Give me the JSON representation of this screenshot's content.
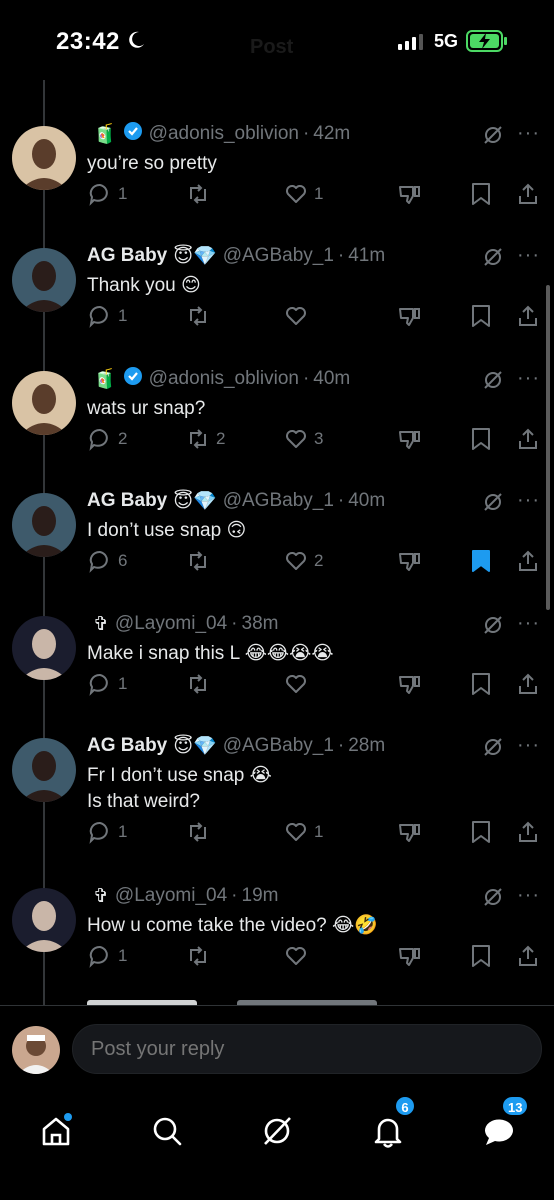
{
  "status": {
    "time": "23:42",
    "network": "5G"
  },
  "header_ghost": "Post",
  "tweets": [
    {
      "display_name": "",
      "badge_emoji": "🧃",
      "verified": true,
      "handle": "@adonis_oblivion",
      "ago": "42m",
      "lines": [
        "you’re so pretty"
      ],
      "emoji": "",
      "replies": "1",
      "reposts": "",
      "likes": "1",
      "bookmarked": false
    },
    {
      "display_name": "AG Baby",
      "badge_emoji": "😇💎",
      "verified": false,
      "handle": "@AGBaby_1",
      "ago": "41m",
      "lines": [
        "Thank you"
      ],
      "emoji": "😊",
      "replies": "1",
      "reposts": "",
      "likes": "",
      "bookmarked": false
    },
    {
      "display_name": "",
      "badge_emoji": "🧃",
      "verified": true,
      "handle": "@adonis_oblivion",
      "ago": "40m",
      "lines": [
        "wats ur snap?"
      ],
      "emoji": "",
      "replies": "2",
      "reposts": "2",
      "likes": "3",
      "bookmarked": false
    },
    {
      "display_name": "AG Baby",
      "badge_emoji": "😇💎",
      "verified": false,
      "handle": "@AGBaby_1",
      "ago": "40m",
      "lines": [
        "I don’t use snap"
      ],
      "emoji": "🙃",
      "replies": "6",
      "reposts": "",
      "likes": "2",
      "bookmarked": true
    },
    {
      "display_name": "",
      "badge_emoji": "✞",
      "verified": false,
      "handle": "@Layomi_04",
      "ago": "38m",
      "lines": [
        "Make i snap this L"
      ],
      "emoji": "😂😂😭😭",
      "replies": "1",
      "reposts": "",
      "likes": "",
      "bookmarked": false
    },
    {
      "display_name": "AG Baby",
      "badge_emoji": "😇💎",
      "verified": false,
      "handle": "@AGBaby_1",
      "ago": "28m",
      "lines": [
        "Fr I don’t use snap",
        "Is that weird?"
      ],
      "emoji": "😭",
      "replies": "1",
      "reposts": "",
      "likes": "1",
      "bookmarked": false
    },
    {
      "display_name": "",
      "badge_emoji": "✞",
      "verified": false,
      "handle": "@Layomi_04",
      "ago": "19m",
      "lines": [
        "How u come take the video?"
      ],
      "emoji": "😂🤣",
      "replies": "1",
      "reposts": "",
      "likes": "",
      "bookmarked": false
    }
  ],
  "reply": {
    "placeholder": "Post your reply"
  },
  "nav": {
    "notifications_count": "6",
    "messages_count": "13",
    "items": [
      "home-icon",
      "search-icon",
      "grok-icon",
      "bell-icon",
      "messages-icon"
    ]
  },
  "colors": {
    "accent": "#1d9bf0",
    "muted": "#71767b",
    "text": "#e7e9ea",
    "background": "#000000"
  }
}
